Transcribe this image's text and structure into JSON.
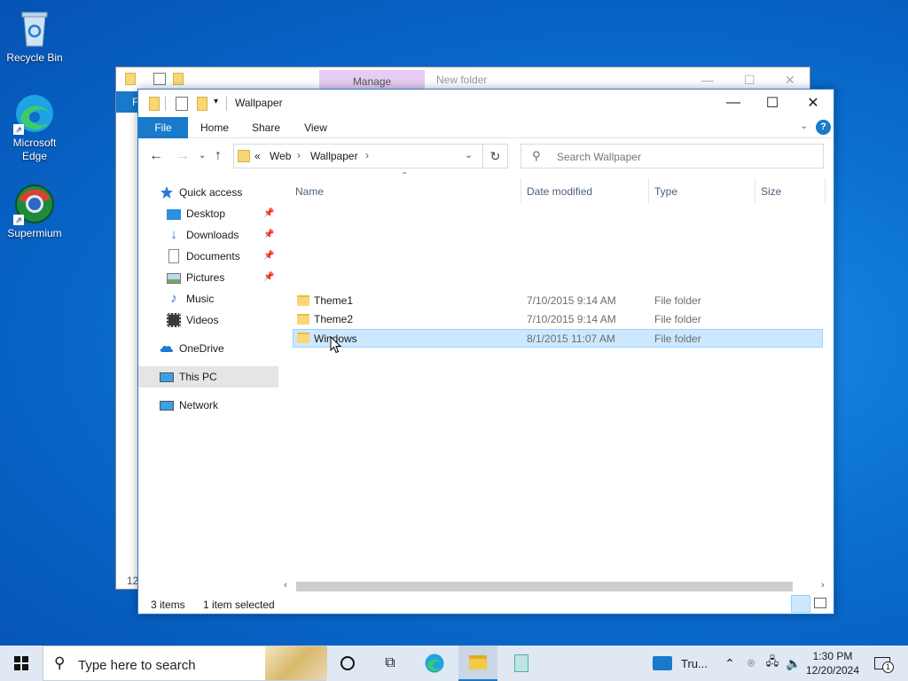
{
  "desktop": {
    "icons": [
      {
        "label": "Recycle Bin"
      },
      {
        "label": "Microsoft Edge"
      },
      {
        "label": "Supermium"
      }
    ]
  },
  "background_window": {
    "manage_tab": "Manage",
    "title": "New folder",
    "ribbon_file": "F",
    "status_fragment": "12"
  },
  "window": {
    "title": "Wallpaper",
    "ribbon_tabs": [
      "File",
      "Home",
      "Share",
      "View"
    ],
    "breadcrumb": {
      "overflow": "«",
      "parts": [
        "Web",
        "Wallpaper"
      ]
    },
    "search_placeholder": "Search Wallpaper",
    "nav": {
      "quick_access": "Quick access",
      "items": [
        "Desktop",
        "Downloads",
        "Documents",
        "Pictures",
        "Music",
        "Videos"
      ],
      "onedrive": "OneDrive",
      "this_pc": "This PC",
      "network": "Network"
    },
    "columns": [
      "Name",
      "Date modified",
      "Type",
      "Size"
    ],
    "files": [
      {
        "name": "Theme1",
        "date": "7/10/2015 9:14 AM",
        "type": "File folder",
        "selected": false
      },
      {
        "name": "Theme2",
        "date": "7/10/2015 9:14 AM",
        "type": "File folder",
        "selected": false
      },
      {
        "name": "Windows",
        "date": "8/1/2015 11:07 AM",
        "type": "File folder",
        "selected": true
      }
    ],
    "status": {
      "items": "3 items",
      "selected": "1 item selected"
    }
  },
  "taskbar": {
    "search_placeholder": "Type here to search",
    "tray_app_label": "Tru...",
    "time": "1:30 PM",
    "date": "12/20/2024",
    "notification_count": "1"
  },
  "colors": {
    "accent": "#1979ca",
    "selection": "#cce8ff",
    "manage_tab": "#e6cdf3",
    "taskbar": "#dfe8f3"
  }
}
